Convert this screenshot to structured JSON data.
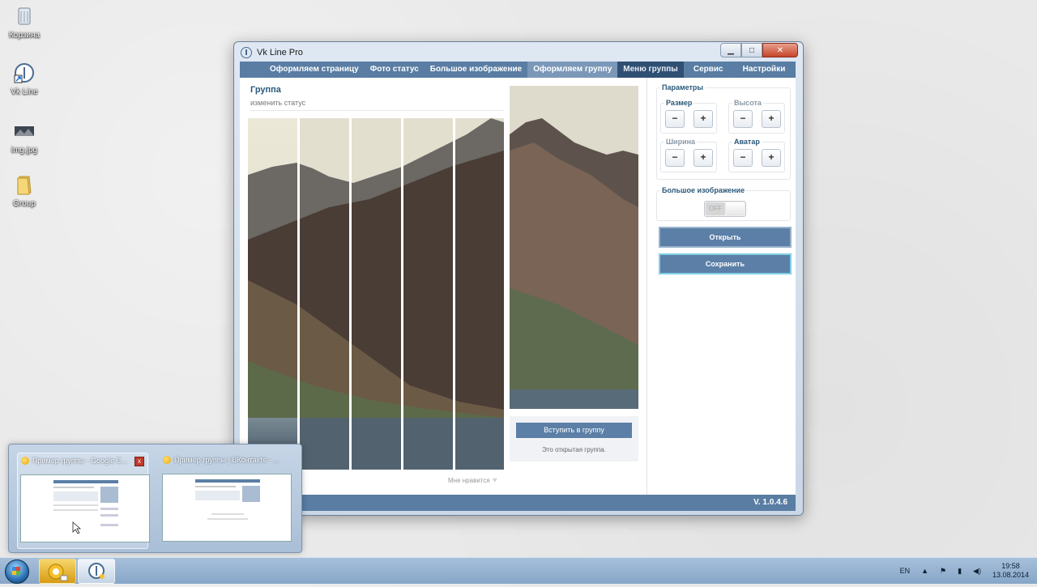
{
  "desktop": {
    "icons": [
      {
        "label": "Корзина",
        "icon": "recycle-bin-icon"
      },
      {
        "label": "Vk Line",
        "icon": "vk-line-shortcut-icon"
      },
      {
        "label": "img.jpg",
        "icon": "image-file-icon"
      },
      {
        "label": "Group",
        "icon": "folder-icon"
      }
    ]
  },
  "window": {
    "title": "Vk Line Pro",
    "menu": [
      "Оформляем страницу",
      "Фото статус",
      "Большое изображение",
      "Оформляем группу",
      "Меню группы",
      "Сервис",
      "Настройки"
    ],
    "active_menu": "Оформляем группу",
    "version": "V. 1.0.4.6"
  },
  "preview_panel": {
    "group_title": "Группа",
    "group_status": "изменить статус",
    "like_label": "Мне нравится",
    "join_button": "Вступить в группу",
    "open_group_text": "Это открытая группа."
  },
  "params": {
    "title": "Параметры",
    "size_label": "Размер",
    "height_label": "Высота",
    "width_label": "Ширина",
    "avatar_label": "Аватар",
    "minus": "−",
    "plus": "+",
    "big_image_label": "Большое изображение",
    "toggle_state": "OFF",
    "open_button": "Открыть",
    "save_button": "Сохранить"
  },
  "taskbar_preview": {
    "cards": [
      {
        "title": "Пример группы - Google C...",
        "close": "x"
      },
      {
        "title": "Пример группы | ВКонтакте - ..."
      }
    ]
  },
  "tray": {
    "lang": "EN",
    "time": "19:58",
    "date": "13.08.2014"
  }
}
